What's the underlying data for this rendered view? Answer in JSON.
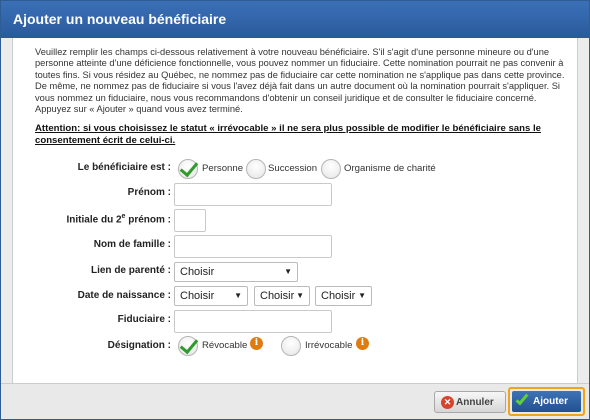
{
  "dialog": {
    "title": "Ajouter un nouveau bénéficiaire",
    "intro": "Veuillez remplir les champs ci-dessous relativement à votre nouveau bénéficiaire. S'il s'agit d'une personne mineure ou d'une personne atteinte d'une déficience fonctionnelle, vous pouvez nommer un fiduciaire. Cette nomination pourrait ne pas convenir à toutes fins. Si vous résidez au Québec, ne nommez pas de fiduciaire car cette nomination ne s'applique pas dans cette province. De même, ne nommez pas de fiduciaire si vous l'avez déjà fait dans un autre document où la nomination pourrait s'appliquer. Si vous nommez un fiduciaire, nous vous recommandons d'obtenir un conseil juridique et de consulter le fiduciaire concerné. Appuyez sur « Ajouter » quand vous avez terminé.",
    "warning": "Attention: si vous choisissez le statut « irrévocable » il ne sera plus possible de modifier le bénéficiaire sans le consentement écrit de celui-ci."
  },
  "form": {
    "beneficiary_type_label": "Le bénéficiaire est :",
    "beneficiary_types": [
      "Personne",
      "Succession",
      "Organisme de charité"
    ],
    "beneficiary_type_selected": "Personne",
    "first_name_label": "Prénom :",
    "first_name_value": "",
    "initial_label": "Initiale du 2e prénom :",
    "initial_value": "",
    "last_name_label": "Nom de famille :",
    "last_name_value": "",
    "relationship_label": "Lien de parenté :",
    "relationship_value": "Choisir",
    "birthdate_label": "Date de naissance :",
    "birthdate_day": "Choisir",
    "birthdate_month": "Choisir",
    "birthdate_year": "Choisir",
    "trustee_label": "Fiduciaire :",
    "trustee_value": "",
    "designation_label": "Désignation :",
    "designations": [
      "Révocable",
      "Irrévocable"
    ],
    "designation_selected": "Révocable",
    "info_icon_glyph": "i"
  },
  "footer": {
    "cancel_label": "Annuler",
    "add_label": "Ajouter",
    "cancel_glyph": "✕"
  },
  "colors": {
    "title_bar": "#2f62a6",
    "check_green": "#2e9c2a",
    "info_orange": "#e07b10",
    "focus_outline": "#f0a418"
  }
}
